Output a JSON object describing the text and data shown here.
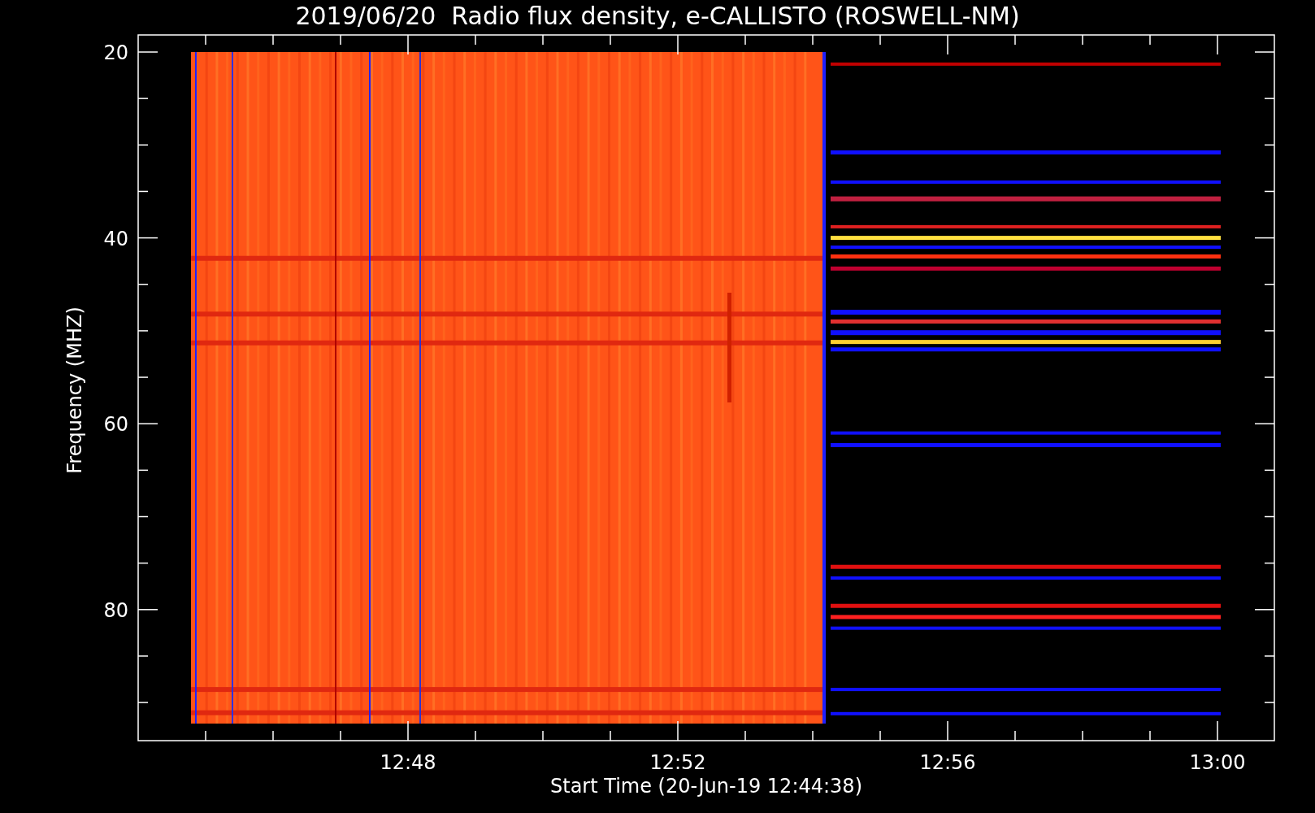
{
  "plot": {
    "title": "2019/06/20  Radio flux density, e-CALLISTO (ROSWELL-NM)",
    "x_label": "Start Time (20-Jun-19 12:44:38)",
    "y_label": "Frequency (MHZ)",
    "x_tick_labels": [
      "12:48",
      "12:52",
      "12:56",
      "13:00"
    ],
    "y_tick_labels": [
      "20",
      "40",
      "60",
      "80"
    ]
  }
}
